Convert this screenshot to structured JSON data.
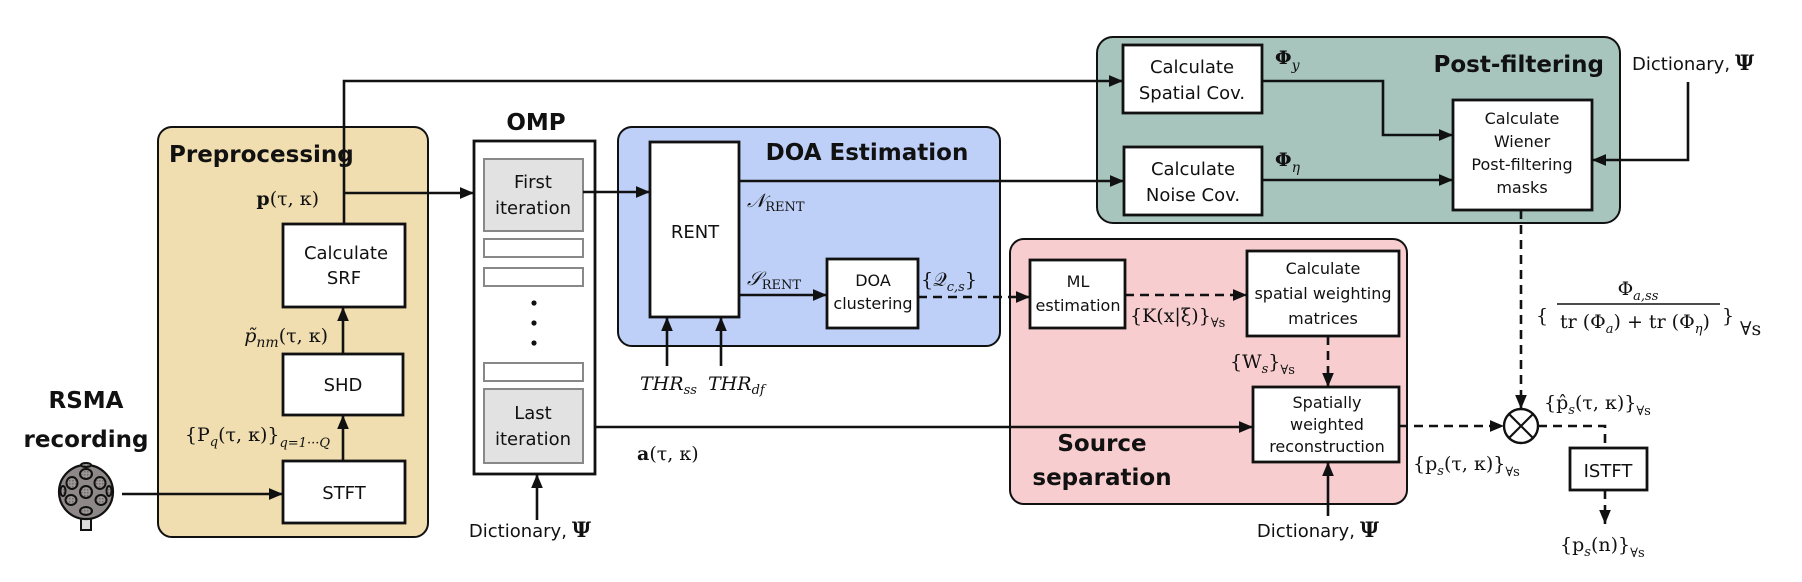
{
  "colors": {
    "preprocessing": "#f1deb0",
    "doa": "#bfd0f8",
    "source_separation": "#f7cdcf",
    "post_filtering": "#a8c5bd",
    "omp_iteration": "#e2e2e2",
    "line": "#111111"
  },
  "input": {
    "title_line1": "RSMA",
    "title_line2": "recording",
    "icon": "spherical-microphone-array-icon"
  },
  "preprocessing": {
    "title": "Preprocessing",
    "stft": "STFT",
    "shd": "SHD",
    "srf_line1": "Calculate",
    "srf_line2": "SRF",
    "label_stft_out": "{P_q(τ,κ)}_{q=1···Q}",
    "label_stft_out_main": "{P",
    "label_stft_out_sub": "q",
    "label_stft_out_args": "(τ, κ)}",
    "label_stft_out_range": "q=1···Q",
    "label_shd_out_main": "p̃",
    "label_shd_out_sub": "nm",
    "label_shd_out_args": "(τ, κ)",
    "label_srf_out_main": "p",
    "label_srf_out_args": "(τ, κ)"
  },
  "omp": {
    "title": "OMP",
    "first_line1": "First",
    "first_line2": "iteration",
    "last_line1": "Last",
    "last_line2": "iteration",
    "dots": "⋮",
    "dictionary_label": "Dictionary,",
    "dictionary_symbol": "Ψ",
    "label_out_main": "a",
    "label_out_args": "(τ, κ)"
  },
  "doa": {
    "title": "DOA Estimation",
    "rent": "RENT",
    "clustering_line1": "DOA",
    "clustering_line2": "clustering",
    "label_noise_main": "𝒩",
    "label_noise_sub": "RENT",
    "label_source_main": "𝒮",
    "label_source_sub": "RENT",
    "label_clusters_main": "{𝒬",
    "label_clusters_sub": "c,s",
    "label_clusters_end": "}",
    "thr_ss_main": "THR",
    "thr_ss_sub": "ss",
    "thr_df_main": "THR",
    "thr_df_sub": "df"
  },
  "source_separation": {
    "title_line1": "Source",
    "title_line2": "separation",
    "ml_line1": "ML",
    "ml_line2": "estimation",
    "csw_line1": "Calculate",
    "csw_line2": "spatial weighting",
    "csw_line3": "matrices",
    "swr_line1": "Spatially",
    "swr_line2": "weighted",
    "swr_line3": "reconstruction",
    "label_k_main": "{K(x|ξ)}",
    "label_k_sub": "∀s",
    "label_w_main": "{W",
    "label_w_sub1": "s",
    "label_w_end": "}",
    "label_w_sub2": "∀s",
    "dictionary_label": "Dictionary,",
    "dictionary_symbol": "Ψ",
    "label_out_main": "{p",
    "label_out_sub": "s",
    "label_out_args": "(τ, κ)}",
    "label_out_forall": "∀s"
  },
  "post_filtering": {
    "title": "Post-filtering",
    "spatial_line1": "Calculate",
    "spatial_line2": "Spatial Cov.",
    "noise_line1": "Calculate",
    "noise_line2": "Noise Cov.",
    "wiener_line1": "Calculate",
    "wiener_line2": "Wiener",
    "wiener_line3": "Post-filtering",
    "wiener_line4": "masks",
    "label_phi_y_main": "Φ",
    "label_phi_y_sub": "y",
    "label_phi_eta_main": "Φ",
    "label_phi_eta_sub": "η",
    "dictionary_label": "Dictionary,",
    "dictionary_symbol": "Ψ",
    "mask_numerator_main": "Φ",
    "mask_numerator_sub": "a,ss",
    "mask_denominator": "tr (Φ",
    "mask_denominator_a": "a",
    "mask_denominator_mid": ") + tr (Φ",
    "mask_denominator_eta": "η",
    "mask_denominator_end": ")",
    "mask_forall": "∀s"
  },
  "output": {
    "multiply_symbol": "⊗",
    "label_filtered_main": "{p̂",
    "label_filtered_sub": "s",
    "label_filtered_args": "(τ, κ)}",
    "label_filtered_forall": "∀s",
    "istft": "ISTFT",
    "label_final_main": "{p",
    "label_final_sub": "s",
    "label_final_args": "(n)}",
    "label_final_forall": "∀s"
  }
}
